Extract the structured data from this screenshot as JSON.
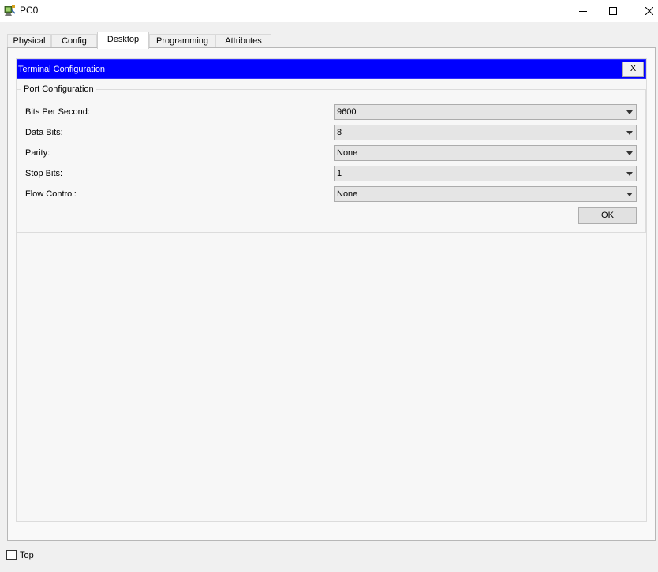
{
  "window": {
    "title": "PC0",
    "icon": "pc-icon",
    "controls": [
      "minimize-icon",
      "maximize-icon",
      "close-icon"
    ]
  },
  "tabs": [
    {
      "label": "Physical",
      "active": false
    },
    {
      "label": "Config",
      "active": false
    },
    {
      "label": "Desktop",
      "active": true
    },
    {
      "label": "Programming",
      "active": false
    },
    {
      "label": "Attributes",
      "active": false
    }
  ],
  "dialog": {
    "title": "Terminal Configuration",
    "close_label": "X",
    "header_color": "#0000ff",
    "group_title": "Port Configuration",
    "fields": [
      {
        "label": "Bits Per Second:",
        "value": "9600"
      },
      {
        "label": "Data Bits:",
        "value": "8"
      },
      {
        "label": "Parity:",
        "value": "None"
      },
      {
        "label": "Stop Bits:",
        "value": "1"
      },
      {
        "label": "Flow Control:",
        "value": "None"
      }
    ],
    "ok_label": "OK"
  },
  "footer": {
    "top_label": "Top",
    "top_checked": false
  }
}
